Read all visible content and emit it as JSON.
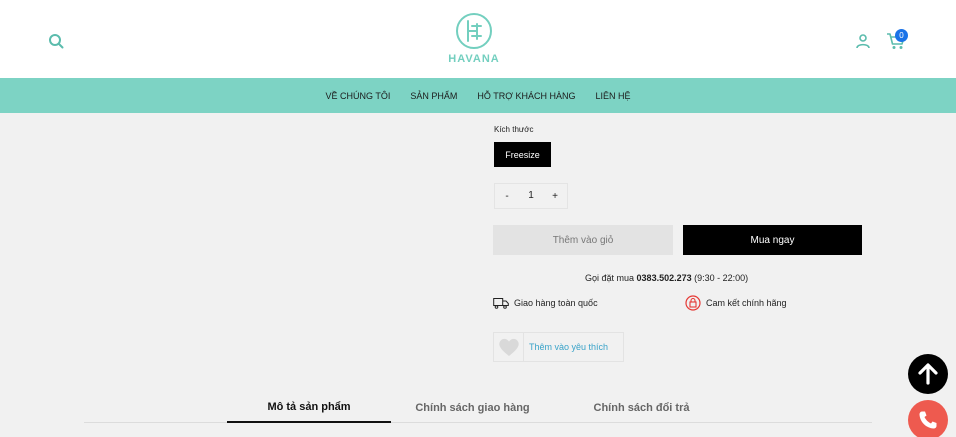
{
  "header": {
    "logo_text": "HAVANA",
    "cart_count": "0",
    "icons": [
      "search-icon",
      "user-icon",
      "cart-icon"
    ]
  },
  "nav": {
    "items": [
      "VỀ CHÚNG TÔI",
      "SẢN PHẨM",
      "HỖ TRỢ KHÁCH HÀNG",
      "LIÊN HỆ"
    ]
  },
  "product": {
    "size_label": "Kích thước",
    "size_option": "Freesize",
    "qty_minus": "-",
    "qty_value": "1",
    "qty_plus": "+",
    "add_to_cart": "Thêm vào giỏ",
    "buy_now": "Mua ngay",
    "hotline_prefix": "Gọi đặt mua",
    "hotline_number": "0383.502.273",
    "hotline_hours": "(9:30 - 22:00)",
    "feature_shipping": "Giao hàng toàn quốc",
    "feature_genuine": "Cam kết chính hãng",
    "wishlist": "Thêm vào yêu thích"
  },
  "tabs": [
    "Mô tả sản phẩm",
    "Chính sách giao hàng",
    "Chính sách đổi trả"
  ],
  "colors": {
    "brand_teal": "#7dd3c4",
    "logo_teal": "#73cfbf",
    "badge_blue": "#1a73e8",
    "call_red": "#ee5a4f",
    "link_blue": "#3aa3c9"
  }
}
